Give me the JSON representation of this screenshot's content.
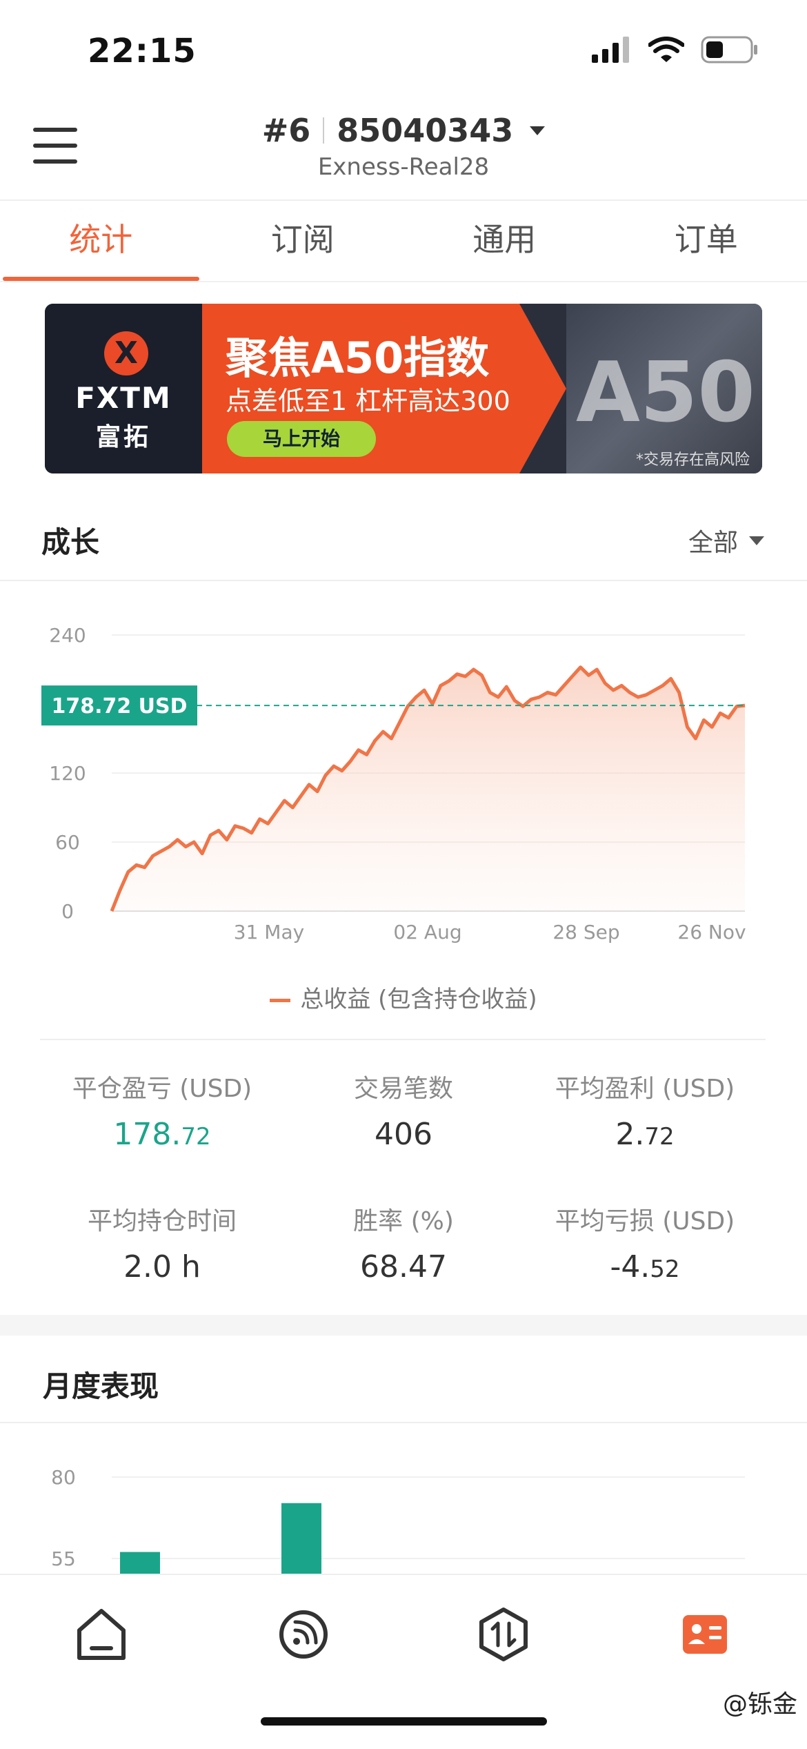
{
  "status_bar": {
    "time": "22:15"
  },
  "header": {
    "account_index": "#6",
    "account_number": "85040343",
    "server": "Exness-Real28"
  },
  "tabs": [
    {
      "label": "统计",
      "active": true
    },
    {
      "label": "订阅",
      "active": false
    },
    {
      "label": "通用",
      "active": false
    },
    {
      "label": "订单",
      "active": false
    }
  ],
  "banner": {
    "brand": "FXTM",
    "brand_cn": "富拓",
    "logo_mark": "X",
    "title": "聚焦A50指数",
    "subtitle": "点差低至1 杠杆高达300",
    "cta": "马上开始",
    "graphic_text": "A50",
    "risk_note": "*交易存在高风险"
  },
  "growth": {
    "title": "成长",
    "filter": "全部",
    "legend": "总收益 (包含持仓收益)"
  },
  "chart_data": [
    {
      "type": "area",
      "y_ticks": [
        "240",
        "120",
        "60",
        "0"
      ],
      "x_ticks": [
        "31 May",
        "02 Aug",
        "28 Sep",
        "26 Nov"
      ],
      "ylim": [
        0,
        240
      ],
      "current_label": "178.72 USD",
      "current_value": 178.72,
      "series": [
        {
          "name": "总收益 (包含持仓收益)",
          "values": [
            0,
            18,
            34,
            40,
            38,
            48,
            52,
            56,
            62,
            56,
            60,
            50,
            66,
            70,
            62,
            74,
            72,
            68,
            80,
            76,
            86,
            96,
            90,
            100,
            110,
            104,
            118,
            126,
            122,
            130,
            140,
            136,
            148,
            156,
            150,
            164,
            178,
            186,
            192,
            180,
            196,
            200,
            206,
            204,
            210,
            205,
            190,
            186,
            195,
            183,
            178,
            184,
            186,
            190,
            188,
            196,
            204,
            212,
            205,
            210,
            198,
            192,
            196,
            190,
            186,
            188,
            192,
            196,
            202,
            190,
            160,
            150,
            166,
            160,
            172,
            168,
            178,
            178.72
          ]
        }
      ]
    },
    {
      "type": "bar",
      "y_ticks": [
        "80",
        "55"
      ],
      "values": [
        57,
        72
      ]
    }
  ],
  "stats": [
    {
      "label": "平仓盈亏 (USD)",
      "int": "178.",
      "dec": "72",
      "accent": true
    },
    {
      "label": "交易笔数",
      "int": "406",
      "dec": "",
      "accent": false
    },
    {
      "label": "平均盈利 (USD)",
      "int": "2.",
      "dec": "72",
      "accent": false
    },
    {
      "label": "平均持仓时间",
      "int": "2.0 h",
      "dec": "",
      "accent": false
    },
    {
      "label": "胜率 (%)",
      "int": "68.47",
      "dec": "",
      "accent": false
    },
    {
      "label": "平均亏损 (USD)",
      "int": "-4.",
      "dec": "52",
      "accent": false
    }
  ],
  "monthly": {
    "title": "月度表现"
  },
  "bottom_nav": [
    "home-icon",
    "signal-icon",
    "trade-icon",
    "profile-card-icon"
  ],
  "watermark": "@铄金",
  "colors": {
    "accent": "#f1643a",
    "green": "#1aa58a",
    "line": "#ef7548"
  }
}
